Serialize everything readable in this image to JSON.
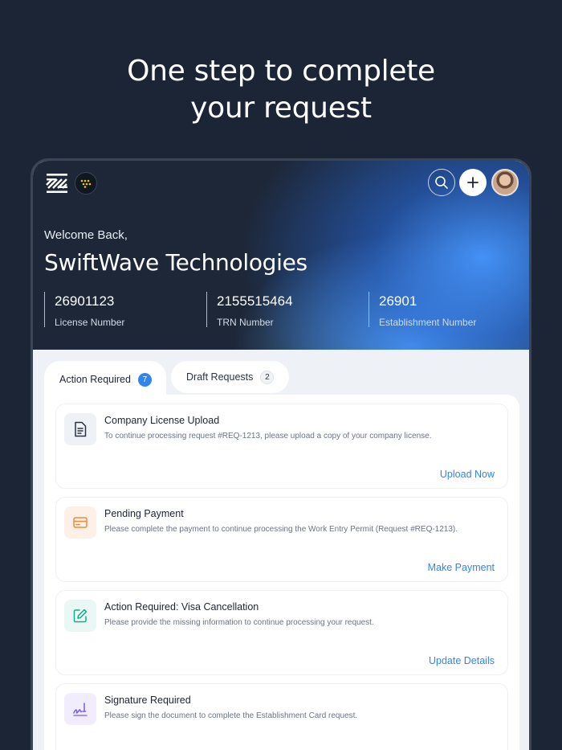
{
  "headline": {
    "line1": "One step to complete",
    "line2": "your request"
  },
  "header": {
    "logo_icon": "striped-logo-icon",
    "badge_icon": "dotted-badge-icon",
    "search_icon": "search-icon",
    "add_icon": "plus-icon",
    "avatar_icon": "user-avatar"
  },
  "welcome": {
    "greeting": "Welcome Back,",
    "company": "SwiftWave Technologies"
  },
  "stats": [
    {
      "value": "26901123",
      "label": "License Number"
    },
    {
      "value": "2155515464",
      "label": "TRN Number"
    },
    {
      "value": "26901",
      "label": "Establishment Number"
    }
  ],
  "tabs": [
    {
      "label": "Action Required",
      "count": "7"
    },
    {
      "label": "Draft Requests",
      "count": "2"
    }
  ],
  "cards": [
    {
      "title": "Company License Upload",
      "description": "To continue processing request #REQ-1213, please upload a copy of your company license.",
      "action": "Upload Now",
      "icon": "document-icon"
    },
    {
      "title": "Pending Payment",
      "description": "Please complete the payment to continue processing the Work Entry Permit (Request #REQ-1213).",
      "action": "Make Payment",
      "icon": "credit-card-icon"
    },
    {
      "title": "Action Required: Visa Cancellation",
      "description": "Please provide the missing information to continue processing your request.",
      "action": "Update Details",
      "icon": "edit-icon"
    },
    {
      "title": "Signature Required",
      "description": "Please sign the document to complete the Establishment Card request.",
      "action": "",
      "icon": "signature-icon"
    }
  ],
  "colors": {
    "accent": "#2f86f0",
    "background": "#1b2535",
    "payment_icon_bg": "#fdf1e7",
    "edit_icon_bg": "#e9f8f4",
    "signature_icon_bg": "#f1edfd"
  }
}
